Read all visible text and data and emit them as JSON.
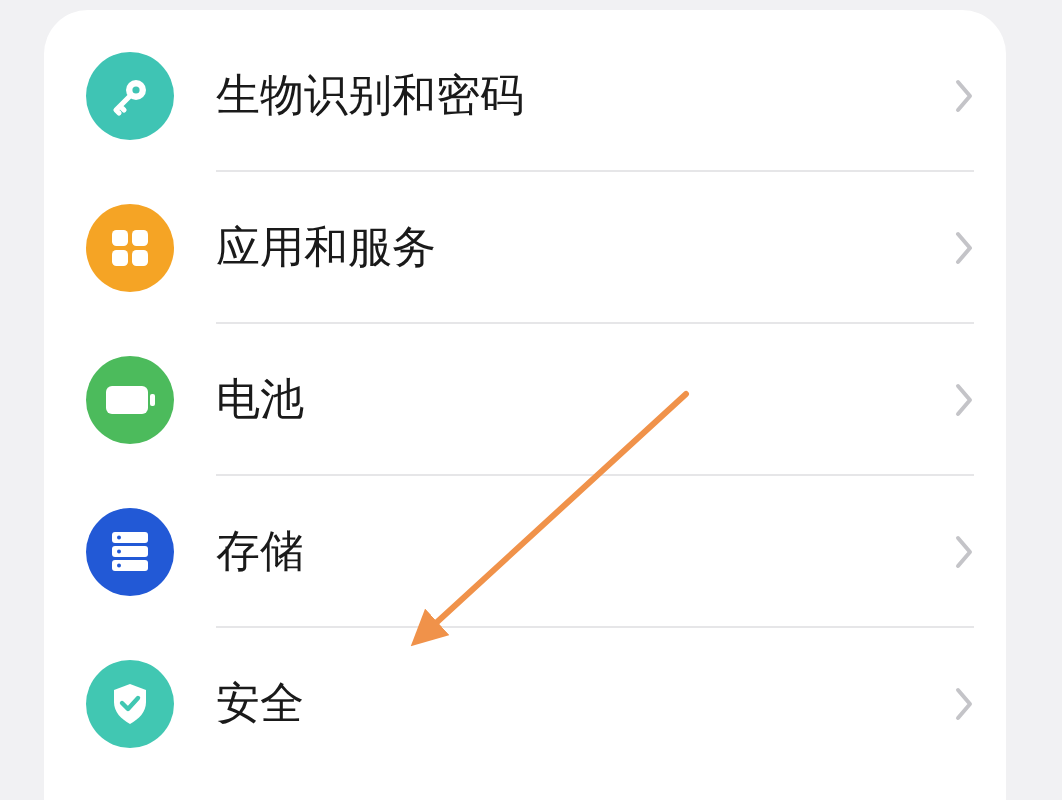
{
  "settings_items": [
    {
      "label": "生物识别和密码",
      "kind": "key",
      "color": "#3fc4b4"
    },
    {
      "label": "应用和服务",
      "kind": "apps",
      "color": "#f5a425"
    },
    {
      "label": "电池",
      "kind": "battery",
      "color": "#4cbb5c"
    },
    {
      "label": "存储",
      "kind": "storage",
      "color": "#2259d6"
    },
    {
      "label": "安全",
      "kind": "shield",
      "color": "#41c7b2"
    }
  ],
  "annotation": {
    "kind": "arrow"
  }
}
